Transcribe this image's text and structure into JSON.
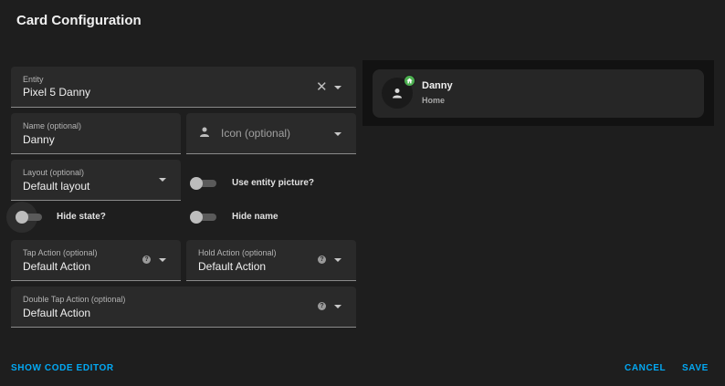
{
  "dialog": {
    "title": "Card Configuration"
  },
  "form": {
    "entity": {
      "label": "Entity",
      "value": "Pixel 5 Danny"
    },
    "name": {
      "label": "Name (optional)",
      "value": "Danny"
    },
    "icon": {
      "placeholder": "Icon (optional)"
    },
    "layout": {
      "label": "Layout (optional)",
      "value": "Default layout"
    },
    "use_entity_picture": {
      "label": "Use entity picture?",
      "checked": false
    },
    "hide_state": {
      "label": "Hide state?",
      "checked": false
    },
    "hide_name": {
      "label": "Hide name",
      "checked": false
    },
    "tap_action": {
      "label": "Tap Action (optional)",
      "value": "Default Action"
    },
    "hold_action": {
      "label": "Hold Action (optional)",
      "value": "Default Action"
    },
    "double_tap_action": {
      "label": "Double Tap Action (optional)",
      "value": "Default Action"
    }
  },
  "preview": {
    "name": "Danny",
    "state": "Home",
    "badge_icon": "home-icon",
    "badge_color": "#4caf50",
    "avatar_icon": "person-icon"
  },
  "footer": {
    "show_code_editor": "SHOW CODE EDITOR",
    "cancel": "CANCEL",
    "save": "SAVE",
    "accent": "#03a9f4"
  }
}
